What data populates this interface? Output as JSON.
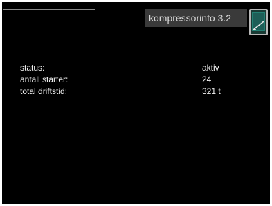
{
  "header": {
    "title": "kompressorinfo 3.2",
    "icon": "device-menu-icon"
  },
  "info": {
    "rows": [
      {
        "label": "status:",
        "value": "aktiv"
      },
      {
        "label": "antall starter:",
        "value": " 24"
      },
      {
        "label": "total driftstid:",
        "value": " 321 t"
      }
    ]
  },
  "colors": {
    "background": "#000000",
    "text": "#f2f2f2",
    "title_bg": "#3a3a3a",
    "title_text": "#d8d8d8",
    "icon_fill": "#1a3a34",
    "icon_accent": "#2bb9a8"
  }
}
